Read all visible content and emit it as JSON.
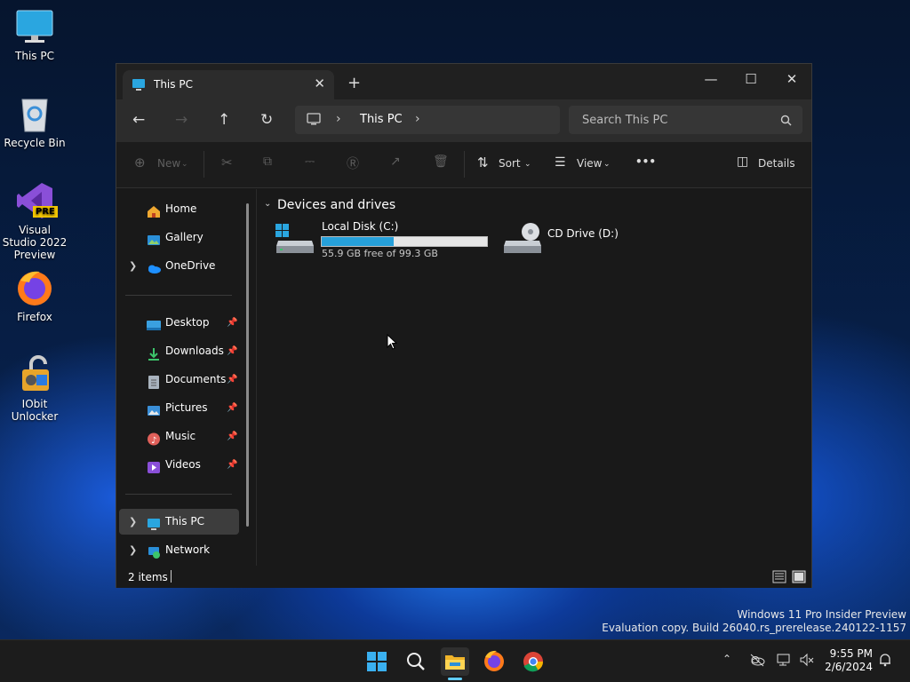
{
  "desktop": {
    "icons": [
      {
        "label": "This PC",
        "icon": "this-pc-icon"
      },
      {
        "label": "Recycle Bin",
        "icon": "recycle-bin-icon"
      },
      {
        "label": "Visual Studio 2022 Preview",
        "icon": "visual-studio-icon",
        "badge": "PRE"
      },
      {
        "label": "Firefox",
        "icon": "firefox-icon"
      },
      {
        "label": "IObit Unlocker",
        "icon": "iobit-unlocker-icon"
      }
    ],
    "watermark": {
      "line1": "Windows 11 Pro Insider Preview",
      "line2": "Evaluation copy. Build 26040.rs_prerelease.240122-1157"
    }
  },
  "explorer": {
    "tab": {
      "title": "This PC",
      "close": "✕"
    },
    "new_tab": "+",
    "window_controls": {
      "minimize": "—",
      "maximize": "☐",
      "close": "✕"
    },
    "address": {
      "segments": [
        "This PC"
      ],
      "separator": "›"
    },
    "search": {
      "placeholder": "Search This PC"
    },
    "toolbar": {
      "new_label": "New",
      "sort_label": "Sort",
      "view_label": "View",
      "more_label": "•••",
      "details_label": "Details"
    },
    "sidebar": {
      "items": [
        {
          "label": "Home",
          "icon": "home-icon"
        },
        {
          "label": "Gallery",
          "icon": "gallery-icon"
        },
        {
          "label": "OneDrive",
          "icon": "onedrive-icon",
          "expandable": true
        },
        {
          "label": "Desktop",
          "icon": "desktop-folder-icon",
          "pinned": true
        },
        {
          "label": "Downloads",
          "icon": "downloads-icon",
          "pinned": true
        },
        {
          "label": "Documents",
          "icon": "documents-icon",
          "pinned": true
        },
        {
          "label": "Pictures",
          "icon": "pictures-icon",
          "pinned": true
        },
        {
          "label": "Music",
          "icon": "music-icon",
          "pinned": true
        },
        {
          "label": "Videos",
          "icon": "videos-icon",
          "pinned": true
        },
        {
          "label": "This PC",
          "icon": "this-pc-icon",
          "expandable": true,
          "selected": true
        },
        {
          "label": "Network",
          "icon": "network-icon",
          "expandable": true
        }
      ]
    },
    "content": {
      "group_title": "Devices and drives",
      "drives": [
        {
          "name": "Local Disk (C:)",
          "free_text": "55.9 GB free of 99.3 GB",
          "used_fraction": 0.437
        },
        {
          "name": "CD Drive (D:)"
        }
      ]
    },
    "status": {
      "item_count": "2 items"
    }
  },
  "taskbar": {
    "apps": [
      "start-icon",
      "search-icon",
      "file-explorer-icon",
      "firefox-icon",
      "chrome-icon"
    ],
    "clock": {
      "time": "9:55 PM",
      "date": "2/6/2024"
    },
    "tray": {
      "chevron": "^"
    }
  },
  "colors": {
    "accent": "#26a0da",
    "window_bg": "#191919",
    "toolbar_bg": "#2c2c2c",
    "selected_bg": "#3d3d3d"
  }
}
